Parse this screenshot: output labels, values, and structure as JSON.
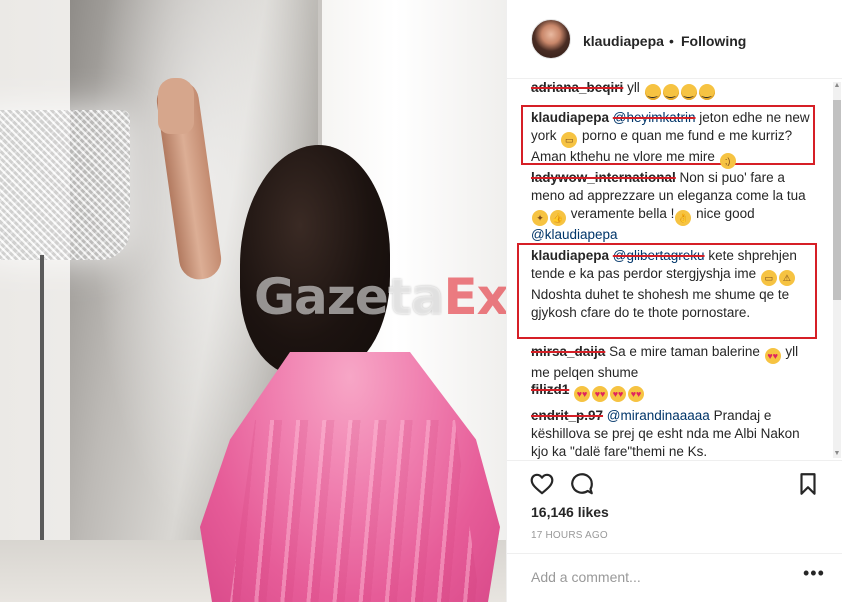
{
  "photo": {
    "watermark_part1": "Gazeta",
    "watermark_part2": "Express"
  },
  "header": {
    "username": "klaudiapepa",
    "separator": "•",
    "follow_status": "Following"
  },
  "comments": [
    {
      "user": "adriana_beqiri",
      "text": "yll",
      "emoji": [
        "neutral",
        "neutral",
        "neutral",
        "neutral"
      ]
    },
    {
      "user": "klaudiapepa",
      "mention": "@heyimkatrin",
      "text1": "jeton edhe ne new york",
      "text2": "porno e quan me fund e me kurriz? Aman kthehu ne vlore me mire"
    },
    {
      "user": "ladywow_international",
      "text1": "Non si puo' fare a meno ad apprezzare un eleganza come la tua",
      "text2": "veramente bella !",
      "text3": "nice good",
      "mention": "@klaudiapepa"
    },
    {
      "user": "klaudiapepa",
      "mention": "@glibertagreku",
      "text1": "kete shprehjen tende e ka pas perdor stergjyshja ime",
      "text2": "Ndoshta duhet te shohesh me shume qe te gjykosh cfare do te thote pornostare."
    },
    {
      "user": "mirsa_daija",
      "text1": "Sa e mire taman balerine",
      "text2": "yll me pelqen shume"
    },
    {
      "user": "filizd1",
      "emoji": [
        "heart",
        "heart",
        "heart",
        "heart"
      ]
    },
    {
      "user": "endrit_p.97",
      "mention": "@mirandinaaaaa",
      "text": "Prandaj e këshillova se prej qe esht nda me Albi Nakon kjo ka \"dalë fare\"themi ne Ks."
    }
  ],
  "stats": {
    "likes": "16,146 likes",
    "time": "17 HOURS AGO"
  },
  "add_comment": {
    "placeholder": "Add a comment...",
    "more": "•••"
  },
  "icons": {
    "like": "heart-outline-icon",
    "comment": "speech-bubble-icon",
    "save": "bookmark-icon"
  },
  "colors": {
    "highlight_box": "#d61f26",
    "mention": "#003569",
    "skirt": "#f080b0"
  }
}
